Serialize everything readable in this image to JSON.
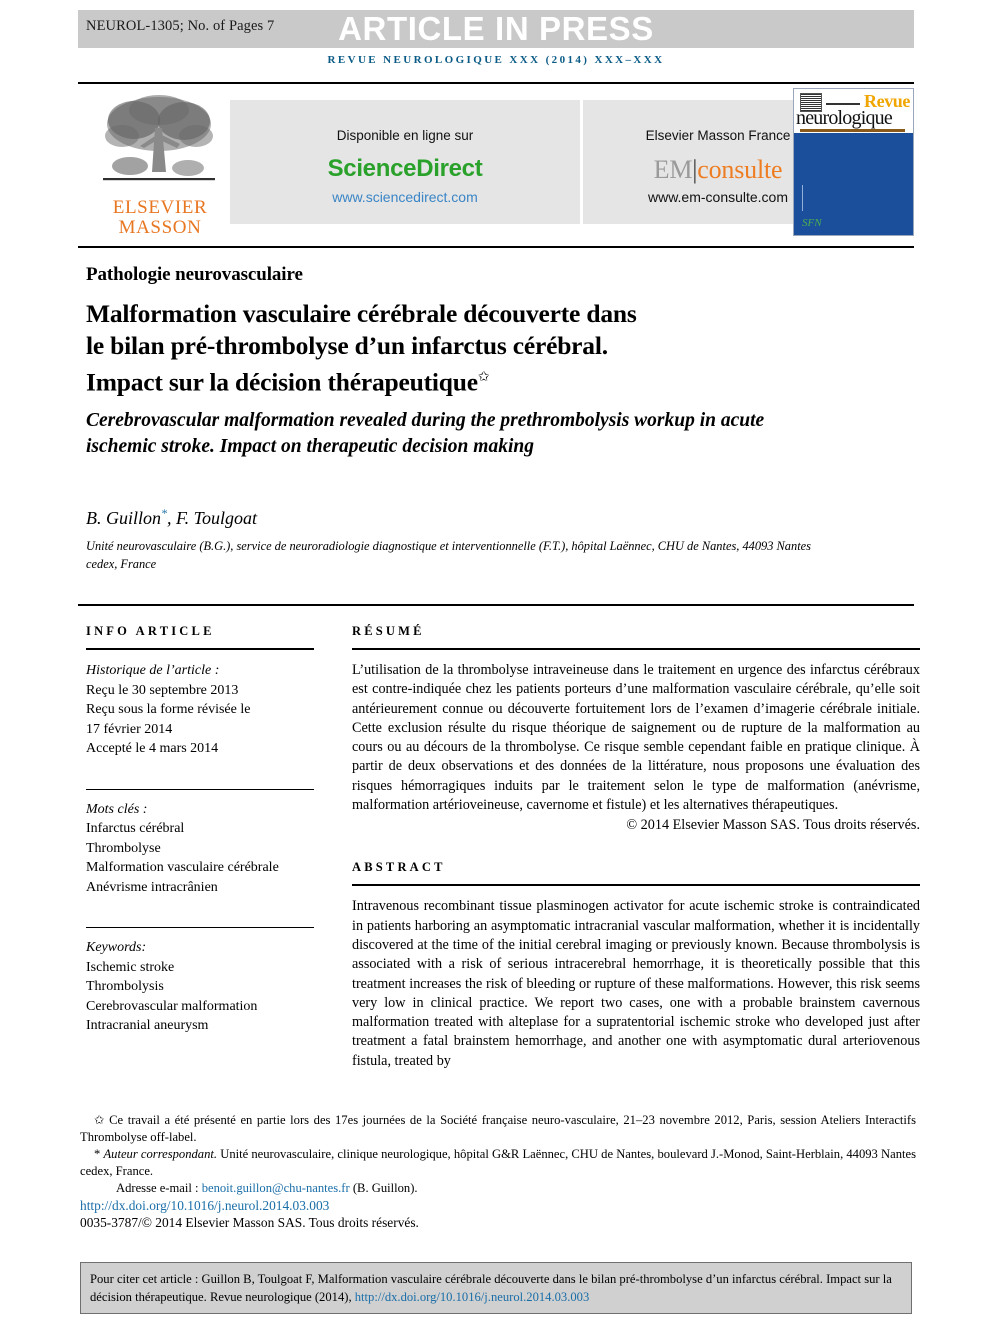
{
  "header": {
    "article_number": "NEUROL-1305; No. of Pages 7",
    "in_press_banner": "ARTICLE IN PRESS",
    "journal_running_head": "REVUE NEUROLOGIQUE XXX (2014) XXX–XXX"
  },
  "publisher_band": {
    "elsevier_logo_line1": "ELSEVIER",
    "elsevier_logo_line2": "MASSON",
    "sciencedirect": {
      "caption": "Disponible en ligne sur",
      "name": "ScienceDirect",
      "url": "www.sciencedirect.com"
    },
    "emconsulte": {
      "caption": "Elsevier Masson France",
      "name_part1": "EM",
      "name_part2": "consulte",
      "url": "www.em-consulte.com"
    },
    "cover": {
      "title_top": "Revue",
      "title_bottom": "neurologique"
    }
  },
  "article": {
    "section_kind": "Pathologie neurovasculaire",
    "title_fr_line1": "Malformation vasculaire cérébrale découverte dans",
    "title_fr_line2": "le bilan pré-thrombolyse d’un infarctus cérébral.",
    "title_fr_line3": "Impact sur la décision thérapeutique",
    "title_fr_marker": "✩",
    "title_en": "Cerebrovascular malformation revealed during the prethrombolysis workup in acute ischemic stroke. Impact on therapeutic decision making",
    "authors": "B. Guillon",
    "authors_marker": "*",
    "authors_rest": ", F. Toulgoat",
    "affiliation": "Unité neurovasculaire (B.G.), service de neuroradiologie diagnostique et interventionnelle (F.T.), hôpital Laënnec, CHU de Nantes, 44093 Nantes cedex, France"
  },
  "info_article": {
    "heading": "INFO ARTICLE",
    "history_label": "Historique de l’article :",
    "history_lines": [
      "Reçu le 30 septembre 2013",
      "Reçu sous la forme révisée le",
      "17 février 2014",
      "Accepté le 4 mars 2014"
    ],
    "keywords_fr_label": "Mots clés :",
    "keywords_fr": [
      "Infarctus cérébral",
      "Thrombolyse",
      "Malformation vasculaire cérébrale",
      "Anévrisme intracrânien"
    ],
    "keywords_en_label": "Keywords:",
    "keywords_en": [
      "Ischemic stroke",
      "Thrombolysis",
      "Cerebrovascular malformation",
      "Intracranial aneurysm"
    ]
  },
  "resume": {
    "heading": "RÉSUMÉ",
    "text": "L’utilisation de la thrombolyse intraveineuse dans le traitement en urgence des infarctus cérébraux est contre-indiquée chez les patients porteurs d’une malformation vasculaire cérébrale, qu’elle soit antérieurement connue ou découverte fortuitement lors de l’examen d’imagerie cérébrale initiale. Cette exclusion résulte du risque théorique de saignement ou de rupture de la malformation au cours ou au décours de la thrombolyse. Ce risque semble cependant faible en pratique clinique. À partir de deux observations et des données de la littérature, nous proposons une évaluation des risques hémorragiques induits par le traitement selon le type de malformation (anévrisme, malformation artérioveineuse, cavernome et fistule) et les alternatives thérapeutiques.",
    "copyright": "© 2014 Elsevier Masson SAS. Tous droits réservés."
  },
  "abstract": {
    "heading": "ABSTRACT",
    "text": "Intravenous recombinant tissue plasminogen activator for acute ischemic stroke is contraindicated in patients harboring an asymptomatic intracranial vascular malformation, whether it is incidentally discovered at the time of the initial cerebral imaging or previously known. Because thrombolysis is associated with a risk of serious intracerebral hemorrhage, it is theoretically possible that this treatment increases the risk of bleeding or rupture of these malformations. However, this risk seems very low in clinical practice. We report two cases, one with a probable brainstem cavernous malformation treated with alteplase for a supratentorial ischemic stroke who developed just after treatment a fatal brainstem hemorrhage, and another one with asymptomatic dural arteriovenous fistula, treated by"
  },
  "footnotes": {
    "star_note": "Ce travail a été présenté en partie lors des 17es journées de la Société française neuro-vasculaire, 21–23 novembre 2012, Paris, session Ateliers Interactifs Thrombolyse off-label.",
    "star_marker": "✩",
    "corresponding_marker": "*",
    "corresponding_label": "Auteur correspondant.",
    "corresponding_text": "Unité neurovasculaire, clinique neurologique, hôpital G&R Laënnec, CHU de Nantes, boulevard J.-Monod, Saint-Herblain, 44093 Nantes cedex, France.",
    "email_label": "Adresse e-mail :",
    "email": "benoit.guillon@chu-nantes.fr",
    "email_owner": "(B. Guillon).",
    "doi": "http://dx.doi.org/10.1016/j.neurol.2014.03.003",
    "issn_copyright": "0035-3787/© 2014 Elsevier Masson SAS. Tous droits réservés."
  },
  "citation_box": {
    "text": "Pour citer cet article : Guillon B, Toulgoat F, Malformation vasculaire cérébrale découverte dans le bilan pré-thrombolyse d’un infarctus cérébral. Impact sur la décision thérapeutique. Revue neurologique (2014), ",
    "doi": "http://dx.doi.org/10.1016/j.neurol.2014.03.003"
  },
  "colors": {
    "journal_blue": "#0b5b87",
    "link_blue": "#1a6ea8",
    "elsevier_orange": "#e87722",
    "sciencedirect_green": "#2aa12a",
    "banner_gray": "#c9c9c9",
    "panel_gray": "#e5e5e5",
    "cover_blue": "#1b4f9c"
  }
}
